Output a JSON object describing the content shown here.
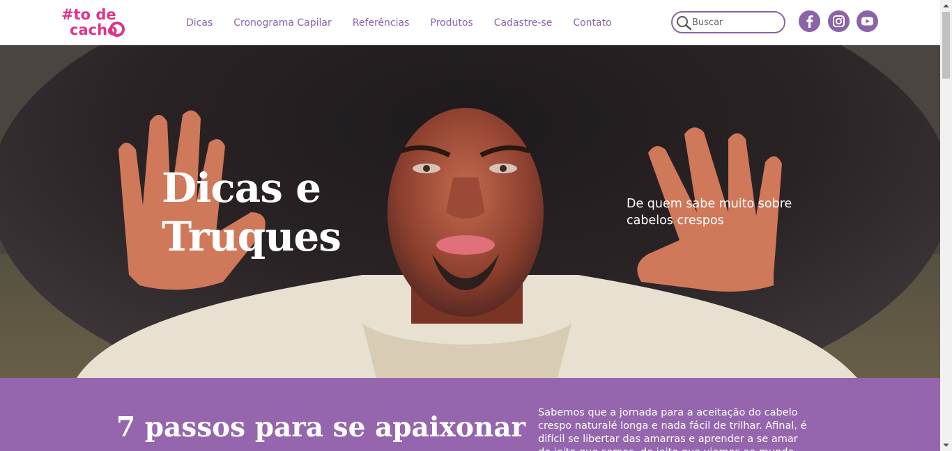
{
  "brand": {
    "logo_text": "#todecacho",
    "color_pink": "#e0328a",
    "color_purple": "#8a64a6"
  },
  "nav": {
    "items": [
      {
        "label": "Dicas"
      },
      {
        "label": "Cronograma Capilar"
      },
      {
        "label": "Referências"
      },
      {
        "label": "Produtos"
      },
      {
        "label": "Cadastre-se"
      },
      {
        "label": "Contato"
      }
    ]
  },
  "search": {
    "placeholder": "Buscar",
    "icon": "search-icon"
  },
  "social": [
    {
      "icon": "facebook-icon"
    },
    {
      "icon": "instagram-icon"
    },
    {
      "icon": "youtube-icon"
    }
  ],
  "hero": {
    "title": "Dicas e Truques",
    "subtitle": "De quem sabe muito sobre cabelos crespos"
  },
  "intro": {
    "title": "7 passos para se apaixonar",
    "text": "Sabemos que a jornada para a aceitação do cabelo crespo naturalé longa e nada fácil de trilhar. Afinal, é difícil se libertar das amarras e aprender a se amar do jeito que somos, do jeito que viemos ao mundo.",
    "background": "#9566ad"
  }
}
